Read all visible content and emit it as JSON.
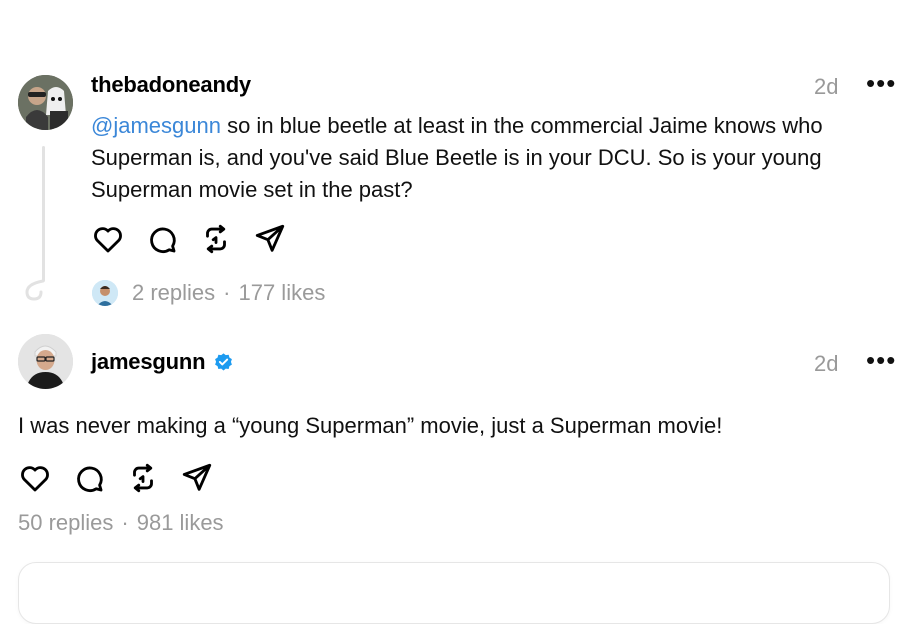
{
  "post1": {
    "username": "thebadoneandy",
    "time": "2d",
    "more": "•••",
    "mention": "@jamesgunn",
    "text": " so in blue beetle at least in the commercial Jaime knows who Superman is, and you've said Blue Beetle is in your DCU. So is your young Superman movie set in the past?",
    "replies": "2 replies",
    "separator": "·",
    "likes": "177 likes"
  },
  "post2": {
    "username": "jamesgunn",
    "verified": true,
    "time": "2d",
    "more": "•••",
    "text": "I was never making a “young Superman” movie, just a Superman movie!",
    "replies": "50 replies",
    "separator": "·",
    "likes": "981 likes"
  },
  "icons": [
    "heart-icon",
    "comment-icon",
    "repost-icon",
    "share-icon"
  ],
  "colors": {
    "mention": "#3b87d8",
    "muted": "#999999",
    "verified": "#1d9bf0"
  }
}
